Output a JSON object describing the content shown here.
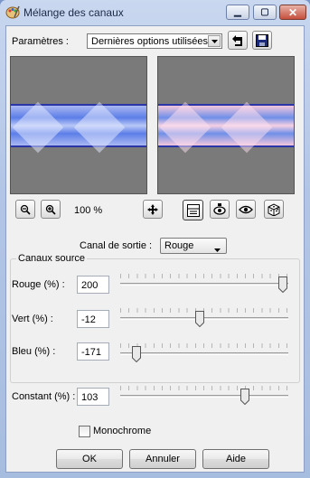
{
  "window": {
    "title": "Mélange des canaux"
  },
  "params": {
    "label": "Paramètres :",
    "selected": "Dernières options utilisées"
  },
  "zoom": {
    "level": "100 %"
  },
  "output": {
    "label": "Canal de sortie :",
    "selected": "Rouge"
  },
  "source": {
    "title": "Canaux source",
    "channels": [
      {
        "label": "Rouge (%) :",
        "value": "200",
        "slider_fraction": 1.0
      },
      {
        "label": "Vert (%) :",
        "value": "-12",
        "slider_fraction": 0.47
      },
      {
        "label": "Bleu (%) :",
        "value": "-171",
        "slider_fraction": 0.07
      }
    ]
  },
  "constant": {
    "label": "Constant (%) :",
    "value": "103",
    "slider_fraction": 0.76
  },
  "monochrome": {
    "label": "Monochrome",
    "checked": false
  },
  "buttons": {
    "ok": "OK",
    "cancel": "Annuler",
    "help": "Aide"
  },
  "colors": {
    "band_border": "#2a35a8",
    "preview_bg": "#7a7a7a"
  }
}
